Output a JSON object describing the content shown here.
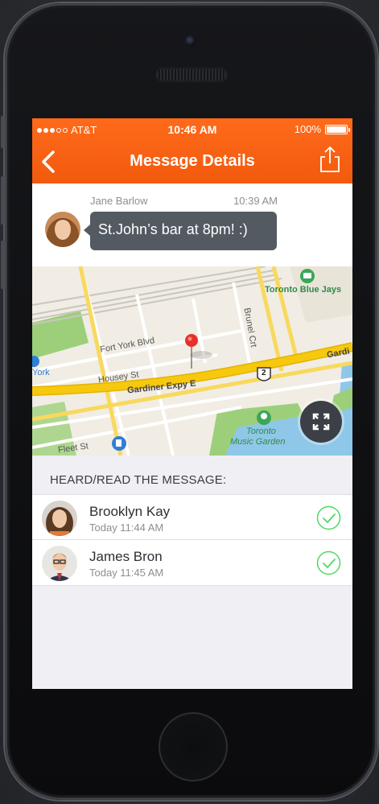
{
  "status_bar": {
    "carrier": "AT&T",
    "time": "10:46 AM",
    "battery_text": "100%",
    "signal_bars_filled": 3,
    "signal_bars_total": 5,
    "battery_level_fraction": 1.0
  },
  "header": {
    "title": "Message Details",
    "back_icon": "chevron-left-icon",
    "share_icon": "share-icon"
  },
  "message": {
    "sender": "Jane Barlow",
    "time": "10:39 AM",
    "text": "St.John’s bar at 8pm! :)"
  },
  "map": {
    "labels": {
      "fort_york": "Fort York Blvd",
      "housey": "Housey St",
      "gardiner": "Gardiner Expy E",
      "gardiner_short": "Gardi",
      "brunel": "Brunel Crt",
      "fleet": "Fleet St",
      "blue_jays": "Toronto Blue Jays",
      "music_garden_1": "Toronto",
      "music_garden_2": "Music Garden",
      "york": "York",
      "route_number": "2"
    },
    "expand_icon": "expand-icon"
  },
  "readers_section": {
    "title": "HEARD/READ THE MESSAGE:",
    "items": [
      {
        "name": "Brooklyn Kay",
        "time": "Today 11:44 AM",
        "status_icon": "check-circle-icon"
      },
      {
        "name": "James Bron",
        "time": "Today 11:45 AM",
        "status_icon": "check-circle-icon"
      }
    ]
  },
  "colors": {
    "accent": "#F25A0E",
    "check_green": "#4CD964",
    "bubble": "#545A62"
  }
}
